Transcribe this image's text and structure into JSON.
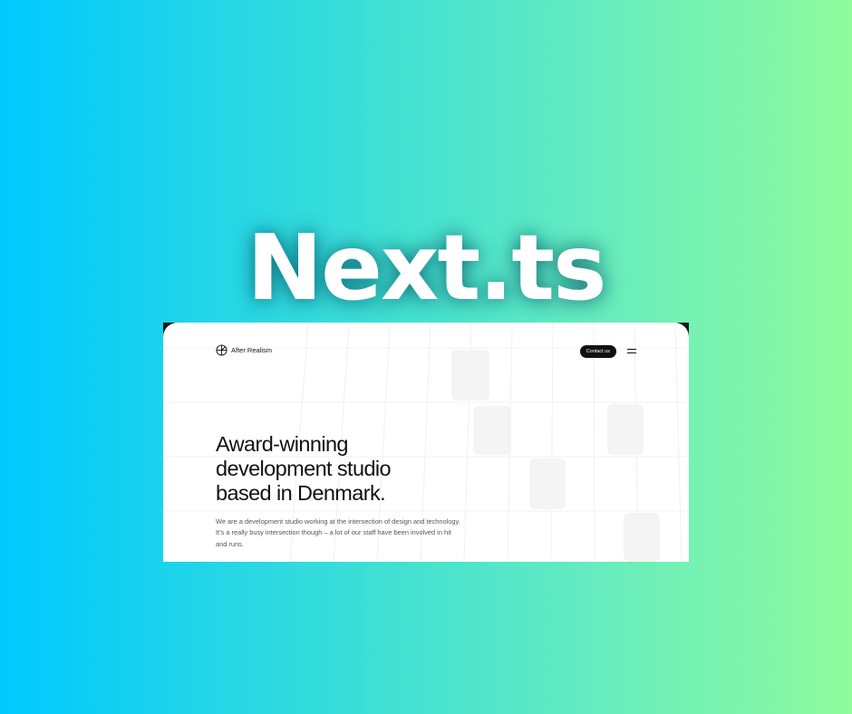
{
  "title": "Next.ts",
  "website": {
    "brand": "After Realism",
    "contact_button": "Contact us",
    "menu_icon": "hamburger-menu-icon",
    "headline_lines": [
      "Award-winning",
      "development studio",
      "based in Denmark."
    ],
    "intro_lines": [
      "We are a development studio working at the intersection of design and technology.",
      "It’s a really busy intersection though – a lot of our staff have been involved in hit",
      "and runs."
    ]
  },
  "colors": {
    "background_gradient_start": "#00c8ff",
    "background_gradient_end": "#8ffb9d",
    "title_color": "#ffffff",
    "page_background": "#ffffff",
    "button_background": "#111111"
  }
}
